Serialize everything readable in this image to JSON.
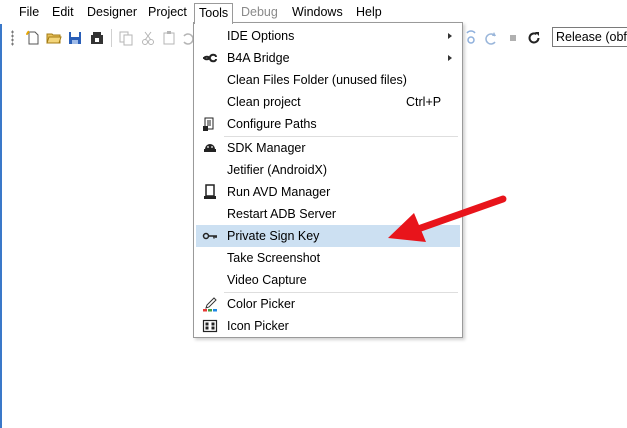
{
  "menubar": {
    "items": [
      {
        "label": "File"
      },
      {
        "label": "Edit"
      },
      {
        "label": "Designer"
      },
      {
        "label": "Project"
      },
      {
        "label": "Tools",
        "open": true
      },
      {
        "label": "Debug",
        "disabled": true
      },
      {
        "label": "Windows"
      },
      {
        "label": "Help"
      }
    ]
  },
  "toolbar": {
    "build_config": "Release (obfu",
    "icons": [
      "new-file-icon",
      "open-folder-icon",
      "save-icon",
      "save-all-icon",
      "copy-icon",
      "cut-icon",
      "paste-icon",
      "undo-icon",
      "step-icon",
      "redo-icon",
      "stop-icon",
      "restart-icon"
    ]
  },
  "tools_menu": {
    "items": [
      {
        "label": "IDE Options",
        "submenu": true,
        "icon": ""
      },
      {
        "label": "B4A Bridge",
        "submenu": true,
        "icon": "bridge-icon"
      },
      {
        "label": "Clean Files Folder (unused files)",
        "icon": ""
      },
      {
        "label": "Clean project",
        "shortcut": "Ctrl+P",
        "icon": ""
      },
      {
        "label": "Configure Paths",
        "icon": "configure-paths-icon"
      },
      {
        "label": "SDK Manager",
        "icon": "sdk-manager-icon"
      },
      {
        "label": "Jetifier (AndroidX)",
        "icon": ""
      },
      {
        "label": "Run AVD Manager",
        "icon": "avd-manager-icon"
      },
      {
        "label": "Restart ADB Server",
        "icon": ""
      },
      {
        "label": "Private Sign Key",
        "icon": "key-icon",
        "highlighted": true
      },
      {
        "label": "Take Screenshot",
        "icon": ""
      },
      {
        "label": "Video Capture",
        "icon": ""
      },
      {
        "label": "Color Picker",
        "icon": "color-picker-icon"
      },
      {
        "label": "Icon Picker",
        "icon": "icon-picker-icon"
      }
    ]
  },
  "annotation": {
    "type": "red-arrow",
    "color": "#e8141b",
    "points_to": "Private Sign Key"
  },
  "colors": {
    "highlight": "#cce0f2",
    "menu_border": "#9a9a9a",
    "disabled_text": "#8a8a8a"
  }
}
